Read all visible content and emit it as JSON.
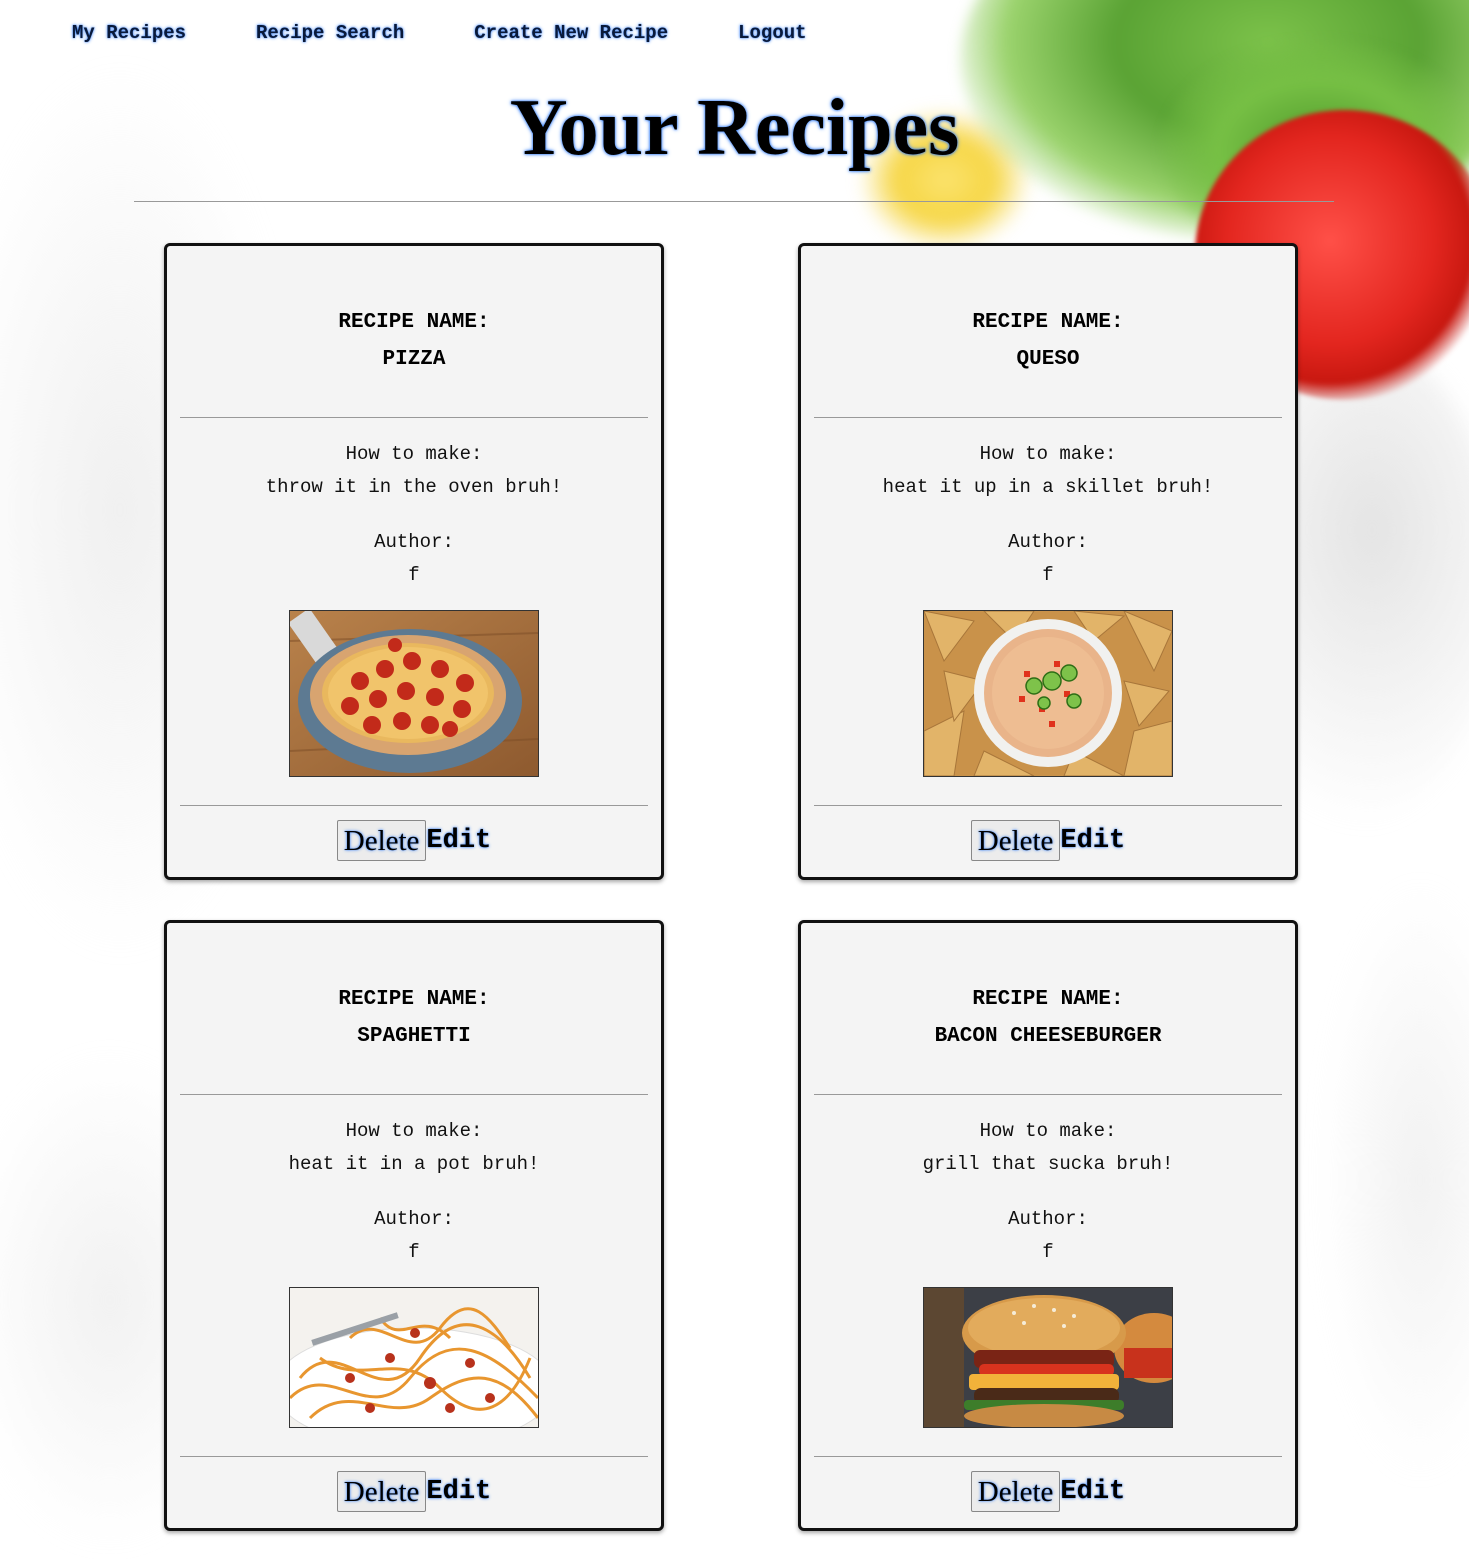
{
  "nav": {
    "items": [
      {
        "label": "My Recipes"
      },
      {
        "label": "Recipe Search"
      },
      {
        "label": "Create New Recipe"
      },
      {
        "label": "Logout"
      }
    ]
  },
  "page": {
    "title": "Your Recipes"
  },
  "labels": {
    "recipe_name": "RECIPE NAME:",
    "how_to_make": "How to make:",
    "author": "Author:",
    "delete": "Delete",
    "edit": "Edit"
  },
  "recipes": [
    {
      "name": "PIZZA",
      "instructions": "throw it in the oven bruh!",
      "author": "f",
      "image_icon": "pizza-photo"
    },
    {
      "name": "QUESO",
      "instructions": "heat it up in a skillet bruh!",
      "author": "f",
      "image_icon": "queso-photo"
    },
    {
      "name": "SPAGHETTI",
      "instructions": "heat it in a pot bruh!",
      "author": "f",
      "image_icon": "spaghetti-photo"
    },
    {
      "name": "BACON CHEESEBURGER",
      "instructions": "grill that sucka bruh!",
      "author": "f",
      "image_icon": "cheeseburger-photo"
    }
  ],
  "colors": {
    "glow": "#3b82f6",
    "card_bg": "#f4f4f4",
    "card_border": "#111111"
  }
}
